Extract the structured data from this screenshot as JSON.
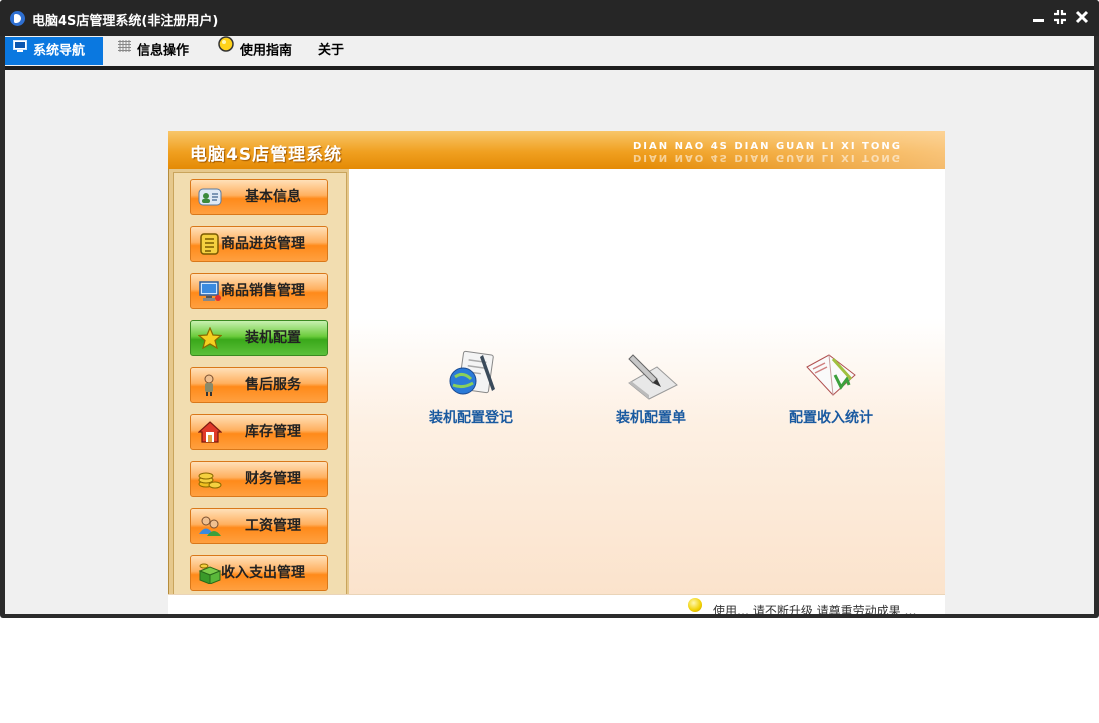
{
  "window": {
    "title": "电脑4S店管理系统(非注册用户)",
    "controls": {
      "minimize": "minimize-icon",
      "restore": "restore-icon",
      "close": "close-icon"
    }
  },
  "menubar": {
    "tabs": [
      {
        "label": "系统导航",
        "icon": "monitor-icon",
        "active": true
      },
      {
        "label": "信息操作",
        "icon": "grid-icon",
        "active": false
      },
      {
        "label": "使用指南",
        "icon": "bulb-icon",
        "active": false
      },
      {
        "label": "关于",
        "icon": "",
        "active": false
      }
    ]
  },
  "banner": {
    "title": "电脑4S店管理系统",
    "subtitle": "DIAN NAO 4S DIAN GUAN LI XI TONG"
  },
  "sidebar": {
    "items": [
      {
        "label": "基本信息",
        "icon": "id-card-icon",
        "active": false
      },
      {
        "label": "商品进货管理",
        "icon": "document-icon",
        "active": false
      },
      {
        "label": "商品销售管理",
        "icon": "computer-icon",
        "active": false
      },
      {
        "label": "装机配置",
        "icon": "star-icon",
        "active": true
      },
      {
        "label": "售后服务",
        "icon": "person-icon",
        "active": false
      },
      {
        "label": "库存管理",
        "icon": "home-icon",
        "active": false
      },
      {
        "label": "财务管理",
        "icon": "coins-icon",
        "active": false
      },
      {
        "label": "工资管理",
        "icon": "users-icon",
        "active": false
      },
      {
        "label": "收入支出管理",
        "icon": "money-box-icon",
        "active": false
      }
    ]
  },
  "main": {
    "functions": [
      {
        "label": "装机配置登记",
        "icon": "globe-register-icon"
      },
      {
        "label": "装机配置单",
        "icon": "pen-paper-icon"
      },
      {
        "label": "配置收入统计",
        "icon": "book-chart-icon"
      }
    ]
  },
  "status": {
    "text": "使用… 请不断升级 请尊重劳动成果 …",
    "icon": "bulb-icon"
  },
  "colors": {
    "titlebar": "#262626",
    "active_tab": "#0a78e0",
    "banner_orange": "#f0a020",
    "nav_orange": "#ff8a1a",
    "nav_active_green": "#3aa81a",
    "function_label": "#1a5aa0"
  }
}
